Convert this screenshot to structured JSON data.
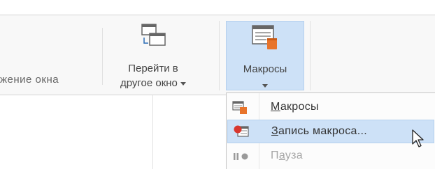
{
  "ribbon": {
    "partial_label": "жение окна",
    "switch_window": {
      "label_line1": "Перейти в",
      "label_line2": "другое окно",
      "icon": "switch-windows-icon"
    },
    "macros_button": {
      "label": "Макросы",
      "icon": "macros-icon"
    }
  },
  "macros_menu": {
    "items": [
      {
        "hotkey": "М",
        "rest": "акросы",
        "icon": "view-macros-icon",
        "state": "normal"
      },
      {
        "hotkey": "З",
        "rest": "апись макроса...",
        "icon": "record-macro-icon",
        "state": "highlighted"
      },
      {
        "pre": "П",
        "hotkey": "а",
        "rest": "уза",
        "icon": "pause-icon",
        "state": "disabled"
      }
    ]
  },
  "colors": {
    "highlight": "#cde1f7",
    "highlight_border": "#b5d0ee",
    "accent_orange": "#e8742b",
    "record_red": "#d8372e"
  }
}
